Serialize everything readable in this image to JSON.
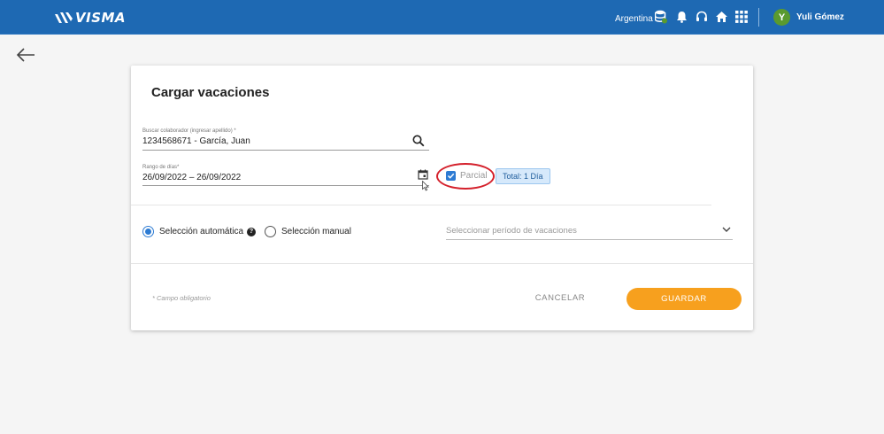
{
  "header": {
    "brand": "VISMA",
    "country": "Argentina",
    "user_initial": "Y",
    "user_name": "Yuli Gómez",
    "icons": [
      "database-icon",
      "bell-icon",
      "headset-icon",
      "home-icon",
      "apps-grid-icon"
    ],
    "bar_color": "#1e69b3"
  },
  "card": {
    "title": "Cargar vacaciones",
    "collaborator": {
      "label": "Buscar colaborador (ingresar apellido) *",
      "value": "1234568671 - García, Juan"
    },
    "date_range": {
      "label": "Rango de días*",
      "value": "26/09/2022 – 26/09/2022"
    },
    "partial": {
      "label": "Parcial",
      "checked": true
    },
    "total_badge": "Total: 1 Día",
    "selection": {
      "automatic_label": "Selección automática",
      "manual_label": "Selección manual",
      "selected": "automatic"
    },
    "period_select": {
      "placeholder": "Seleccionar período de vacaciones"
    },
    "required_note": "* Campo obligatorio",
    "cancel_label": "CANCELAR",
    "save_label": "GUARDAR"
  },
  "colors": {
    "accent": "#2d7bd3",
    "save_button": "#f7a01e",
    "highlight": "#d4202b"
  }
}
